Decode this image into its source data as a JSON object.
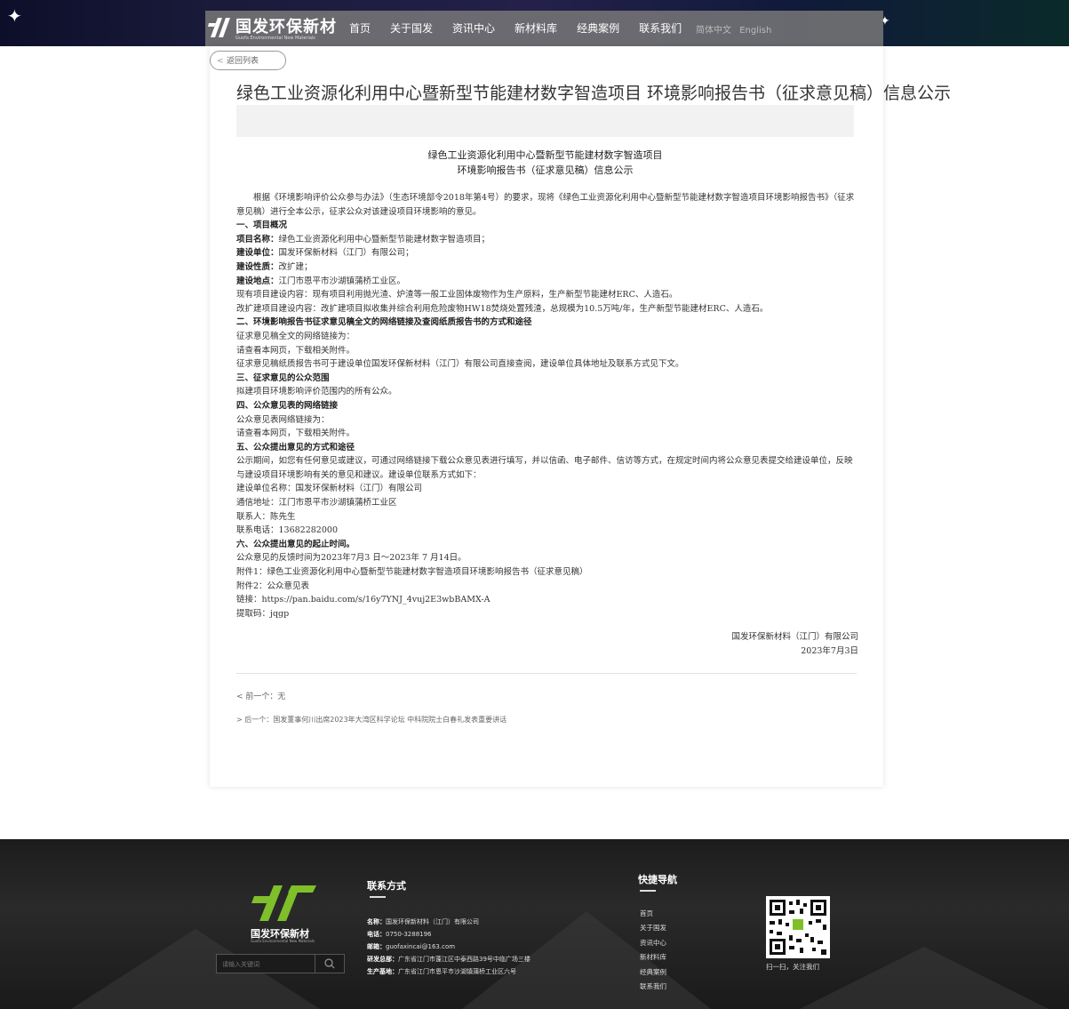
{
  "header": {
    "brand_name": "国发环保新材",
    "brand_sub": "Guofa Environmental New Materials",
    "nav": [
      "首页",
      "关于国发",
      "资讯中心",
      "新材料库",
      "经典案例",
      "联系我们"
    ],
    "lang_zh": "简体中文",
    "lang_en": "English"
  },
  "article": {
    "back_label": "返回列表",
    "title": "绿色工业资源化利用中心暨新型节能建材数字智造项目 环境影响报告书（征求意见稿）信息公示",
    "doc_title_line1": "绿色工业资源化利用中心暨新型节能建材数字智造项目",
    "doc_title_line2": "环境影响报告书（征求意见稿）信息公示",
    "intro": "根据《环境影响评价公众参与办法》（生态环境部令2018年第4号）的要求，现将《绿色工业资源化利用中心暨新型节能建材数字智造项目环境影响报告书》（征求意见稿）进行全本公示，征求公众对该建设项目环境影响的意见。",
    "s1_heading": "一、项目概况",
    "s1_name_label": "项目名称：",
    "s1_name": "绿色工业资源化利用中心暨新型节能建材数字智造项目；",
    "s1_unit_label": "建设单位：",
    "s1_unit": "国发环保新材料（江门）有限公司；",
    "s1_nature_label": "建设性质：",
    "s1_nature": "改扩建；",
    "s1_site_label": "建设地点：",
    "s1_site": "江门市恩平市沙湖镇蒲桥工业区。",
    "s1_existing": "现有项目建设内容：现有项目利用抛光渣、炉渣等一般工业固体废物作为生产原料，生产新型节能建材ERC、人造石。",
    "s1_expand": "改扩建项目建设内容：改扩建项目拟收集并综合利用危险废物HW18焚烧处置残渣，总规模为10.5万吨/年，生产新型节能建材ERC、人造石。",
    "s2_heading": "二、环境影响报告书征求意见稿全文的网络链接及查阅纸质报告书的方式和途径",
    "s2_l1": "征求意见稿全文的网络链接为：",
    "s2_l2": "请查看本网页，下载相关附件。",
    "s2_l3": "征求意见稿纸质报告书可于建设单位国发环保新材料（江门）有限公司直接查阅，建设单位具体地址及联系方式见下文。",
    "s3_heading": "三、征求意见的公众范围",
    "s3_l1": "拟建项目环境影响评价范围内的所有公众。",
    "s4_heading": "四、公众意见表的网络链接",
    "s4_l1": "公众意见表网络链接为：",
    "s4_l2": "请查看本网页，下载相关附件。",
    "s5_heading": "五、公众提出意见的方式和途径",
    "s5_l1": "公示期间，如您有任何意见或建议，可通过网络链接下载公众意见表进行填写，并以信函、电子邮件、信访等方式，在规定时间内将公众意见表提交给建设单位，反映与建设项目环境影响有关的意见和建议。建设单位联系方式如下：",
    "s5_l2": "建设单位名称：国发环保新材料（江门）有限公司",
    "s5_l3": "通信地址：江门市恩平市沙湖镇蒲桥工业区",
    "s5_l4": "联系人：陈先生",
    "s5_l5": "联系电话：13682282000",
    "s6_heading": "六、公众提出意见的起止时间。",
    "s6_l1": "公众意见的反馈时间为2023年7月3 日～2023年 7 月14日。",
    "att1": "附件1：绿色工业资源化利用中心暨新型节能建材数字智造项目环境影响报告书（征求意见稿）",
    "att2": "附件2：公众意见表",
    "link": "链接：https://pan.baidu.com/s/16y7YNJ_4vuj2E3wbBAMX-A",
    "code": "提取码：jqgp",
    "sign_company": "国发环保新材料（江门）有限公司",
    "sign_date": "2023年7月3日",
    "prev": "前一个：无",
    "next": "后一个：国发董事何川出席2023年大湾区科学论坛 中科院院士白春礼发表重要讲话"
  },
  "footer": {
    "brand": "国发环保新材",
    "brand_sub": "Guofa Environmental New Materials",
    "search_placeholder": "请输入关键词",
    "contact_title": "联系方式",
    "contact_name_label": "名称：",
    "contact_name": "国发环保新材料（江门）有限公司",
    "contact_phone_label": "电话：",
    "contact_phone": "0750-3288196",
    "contact_email_label": "邮箱：",
    "contact_email": "guofaxincai@163.com",
    "contact_rd_label": "研发总部：",
    "contact_rd": "广东省江门市蓬江区中泰西路39号中临广场三楼",
    "contact_base_label": "生产基地：",
    "contact_base": "广东省江门市恩平市沙湖镇蒲桥工业区六号",
    "quicknav_title": "快捷导航",
    "quicknav": [
      "首页",
      "关于国发",
      "资讯中心",
      "新材料库",
      "经典案例",
      "联系我们"
    ],
    "qr_caption": "扫一扫，关注我们"
  }
}
